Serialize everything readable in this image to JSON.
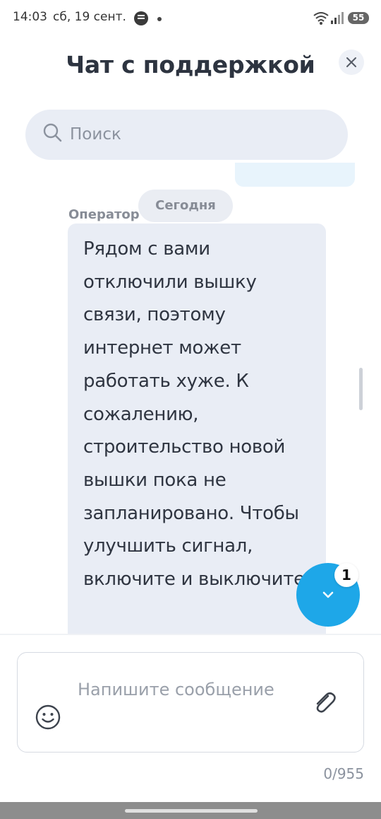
{
  "status_bar": {
    "time": "14:03",
    "date": "сб, 19 сент.",
    "battery": "55"
  },
  "header": {
    "title": "Чат с поддержкой"
  },
  "search": {
    "placeholder": "Поиск"
  },
  "chat": {
    "date_chip": "Сегодня",
    "sender": "Оператор",
    "message": "Рядом с вами отключили вышку связи, поэтому интернет может работать хуже. К сожалению, строительство новой вышки пока не запланировано. Чтобы улучшить сигнал, включите и выключите",
    "unread_count": "1"
  },
  "composer": {
    "placeholder": "Напишите сообщение",
    "counter": "0/955"
  },
  "colors": {
    "accent": "#1ea7e8",
    "bubble": "#e9edf5",
    "title": "#2d3440"
  }
}
